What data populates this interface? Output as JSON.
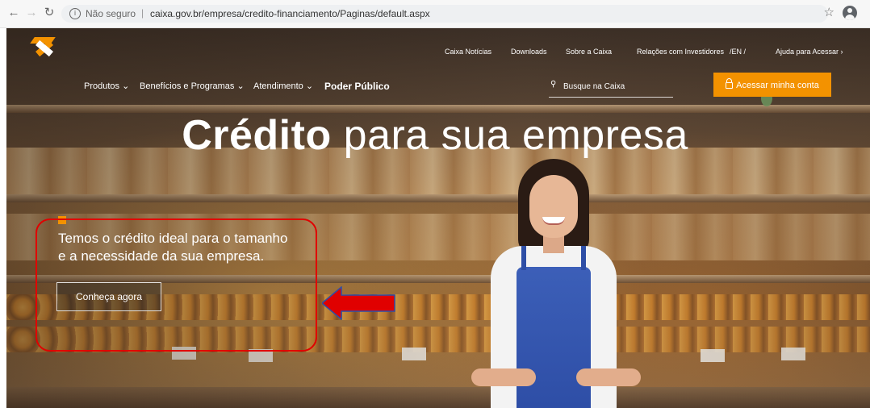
{
  "browser": {
    "not_secure": "Não seguro",
    "separator": "|",
    "url": "caixa.gov.br/empresa/credito-financiamento/Paginas/default.aspx"
  },
  "header": {
    "top_links": [
      "Caixa Notícias",
      "Downloads",
      "Sobre a Caixa",
      "Relações com Investidores",
      "/EN /",
      "Ajuda para Acessar ›"
    ],
    "nav": [
      "Produtos ⌄",
      "Benefícios e Programas ⌄",
      "Atendimento ⌄",
      "Poder Público"
    ],
    "search_placeholder": "Busque na Caixa",
    "login_label": "Acessar minha conta"
  },
  "hero": {
    "title_strong": "Crédito",
    "title_rest": " para sua empresa",
    "subtitle_line1": "Temos o crédito ideal para o tamanho",
    "subtitle_line2": "e a necessidade da sua empresa.",
    "cta_label": "Conheça agora"
  },
  "colors": {
    "brand_orange": "#f39200",
    "annotation_red": "#e00000"
  },
  "icons": [
    "back-icon",
    "forward-icon",
    "reload-icon",
    "info-icon",
    "star-icon",
    "profile-icon",
    "search-icon",
    "lock-icon"
  ]
}
